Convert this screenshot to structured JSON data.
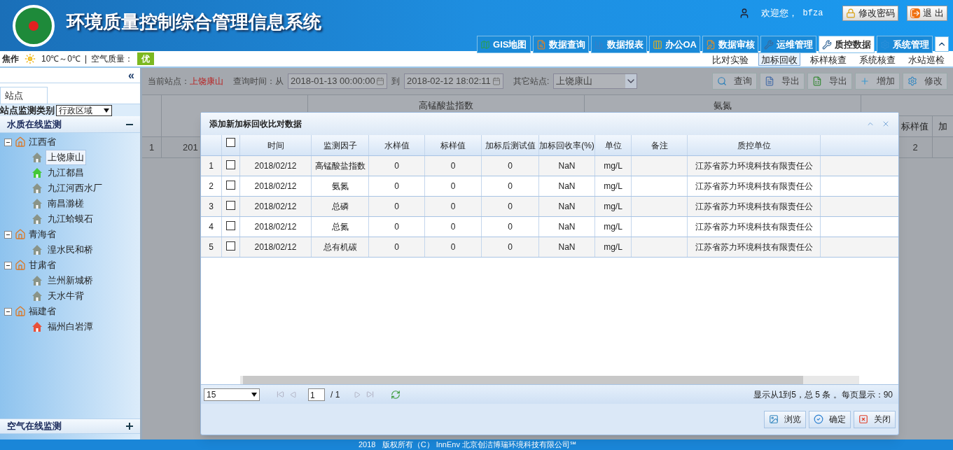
{
  "header": {
    "title": "环境质量控制综合管理信息系统",
    "welcome": "欢迎您，",
    "username": "bfza",
    "buttons": [
      {
        "kind": "password",
        "label": "修改密码"
      },
      {
        "kind": "logout",
        "label": "退 出"
      }
    ],
    "nav_tabs": [
      {
        "kind": "map",
        "label": "GIS地图",
        "selected": false
      },
      {
        "kind": "query",
        "label": "数据查询",
        "selected": false
      },
      {
        "kind": "report",
        "label": "数据报表",
        "selected": false
      },
      {
        "kind": "office",
        "label": "办公OA",
        "selected": false
      },
      {
        "kind": "audit",
        "label": "数据审核",
        "selected": false
      },
      {
        "kind": "tools",
        "label": "运维管理",
        "selected": false
      },
      {
        "kind": "tools",
        "label": "质控数据",
        "selected": true
      },
      {
        "kind": "gear",
        "label": "系统管理",
        "selected": false
      }
    ]
  },
  "info_bar": {
    "city": "焦作",
    "temperature": "10℃～0℃",
    "separator": "|",
    "air_quality_label": "空气质量：",
    "air_quality": "优",
    "sub_tabs": [
      {
        "label": "比对实验",
        "selected": false
      },
      {
        "label": "加标回收",
        "selected": true
      },
      {
        "label": "标样核查",
        "selected": false
      },
      {
        "label": "系统核查",
        "selected": false
      },
      {
        "label": "水站巡检",
        "selected": false
      }
    ]
  },
  "sidebar": {
    "collapse": "«",
    "tab": "站点",
    "filter_label": "站点监测类别",
    "filter_value": "行政区域",
    "section": {
      "title": "水质在线监测",
      "expanded": true
    },
    "tree": [
      {
        "label": "江西省",
        "expanded": true,
        "children": [
          {
            "label": "上饶康山",
            "selected": true,
            "color": "#8a9488"
          },
          {
            "label": "九江都昌",
            "selected": false,
            "color": "#44c838"
          },
          {
            "label": "九江河西水厂",
            "selected": false,
            "color": "#8a9488"
          },
          {
            "label": "南昌滁槎",
            "selected": false,
            "color": "#8a9488"
          },
          {
            "label": "九江蛤蟆石",
            "selected": false,
            "color": "#8a9488"
          }
        ]
      },
      {
        "label": "青海省",
        "expanded": true,
        "children": [
          {
            "label": "湟水民和桥",
            "selected": false,
            "color": "#8a9488"
          }
        ]
      },
      {
        "label": "甘肃省",
        "expanded": true,
        "children": [
          {
            "label": "兰州新城桥",
            "selected": false,
            "color": "#8a9488"
          },
          {
            "label": "天水牛背",
            "selected": false,
            "color": "#8a9488"
          }
        ]
      },
      {
        "label": "福建省",
        "expanded": true,
        "children": [
          {
            "label": "福州白岩潭",
            "selected": false,
            "color": "#e8503a"
          }
        ]
      }
    ],
    "bottom_section": {
      "title": "空气在线监测",
      "expanded": false
    }
  },
  "toolbar": {
    "station_label": "当前站点：",
    "station": "上饶康山",
    "time_label": "查询时间：从",
    "from": "2018-01-13 00:00:00",
    "to_label": "到",
    "to": "2018-02-12 18:02:11",
    "other_label": "其它站点:",
    "other_station": "上饶康山",
    "buttons": [
      {
        "kind": "search",
        "label": "查询"
      },
      {
        "kind": "word",
        "label": "导出"
      },
      {
        "kind": "excel",
        "label": "导出"
      },
      {
        "kind": "add",
        "label": "增加"
      },
      {
        "kind": "gear",
        "label": "修改"
      }
    ]
  },
  "background_grid": {
    "groups": [
      "高锰酸盐指数",
      "氨氮"
    ],
    "columns": [
      "标样值",
      "加"
    ],
    "row": {
      "index": "1",
      "time": "201",
      "value": "2"
    }
  },
  "dialog": {
    "title": "添加新加标回收比对数据",
    "all_checked": false,
    "columns": [
      "时间",
      "监测因子",
      "水样值",
      "标样值",
      "加标后测试值",
      "加标回收率(%)",
      "单位",
      "备注",
      "质控单位"
    ],
    "rows": [
      {
        "index": "1",
        "checked": false,
        "cells": [
          "2018/02/12",
          "高锰酸盐指数",
          "0",
          "0",
          "0",
          "NaN",
          "mg/L",
          "",
          "江苏省苏力环境科技有限责任公"
        ]
      },
      {
        "index": "2",
        "checked": false,
        "cells": [
          "2018/02/12",
          "氨氮",
          "0",
          "0",
          "0",
          "NaN",
          "mg/L",
          "",
          "江苏省苏力环境科技有限责任公"
        ]
      },
      {
        "index": "3",
        "checked": false,
        "cells": [
          "2018/02/12",
          "总磷",
          "0",
          "0",
          "0",
          "NaN",
          "mg/L",
          "",
          "江苏省苏力环境科技有限责任公"
        ]
      },
      {
        "index": "4",
        "checked": false,
        "cells": [
          "2018/02/12",
          "总氮",
          "0",
          "0",
          "0",
          "NaN",
          "mg/L",
          "",
          "江苏省苏力环境科技有限责任公"
        ]
      },
      {
        "index": "5",
        "checked": false,
        "cells": [
          "2018/02/12",
          "总有机碳",
          "0",
          "0",
          "0",
          "NaN",
          "mg/L",
          "",
          "江苏省苏力环境科技有限责任公"
        ]
      }
    ],
    "pager": {
      "page_size": "15",
      "page": "1",
      "total_pages": "/ 1",
      "status": "显示从1到5，总 5 条 。每页显示：90"
    },
    "buttons": [
      {
        "kind": "browse",
        "label": "浏览"
      },
      {
        "kind": "ok",
        "label": "确定"
      },
      {
        "kind": "close",
        "label": "关闭"
      }
    ]
  },
  "footer": "2018   版权所有（C） InnEnv 北京创洁博瑞环境科技有限公司℠"
}
